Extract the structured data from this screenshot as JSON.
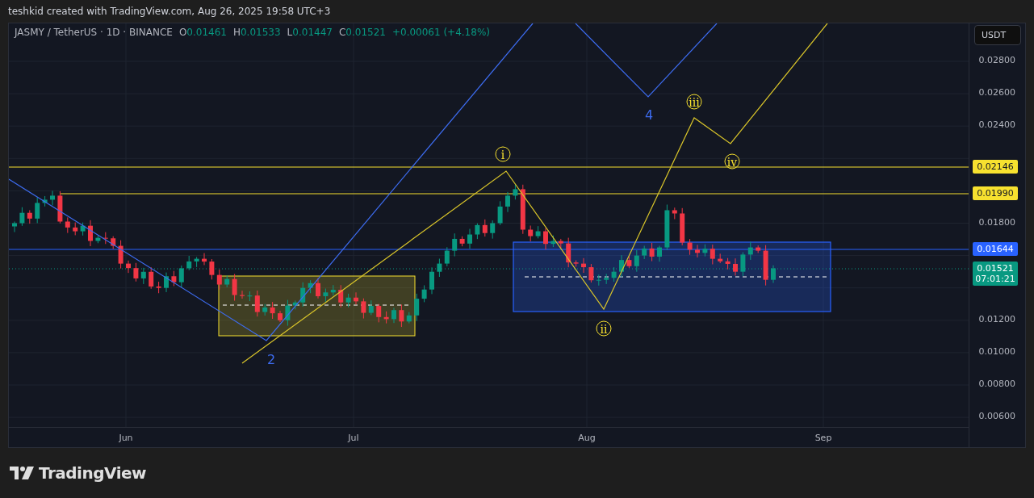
{
  "header": {
    "caption": "teshkid created with TradingView.com, Aug 26, 2025 19:58 UTC+3"
  },
  "legend": {
    "symbol": "JASMY / TetherUS · 1D · BINANCE",
    "ohlc": [
      {
        "key": "O",
        "value": "0.01461"
      },
      {
        "key": "H",
        "value": "0.01533"
      },
      {
        "key": "L",
        "value": "0.01447"
      },
      {
        "key": "C",
        "value": "0.01521"
      }
    ],
    "change": "+0.00061 (+4.18%)"
  },
  "currency_button": "USDT",
  "price_axis": {
    "ticks": [
      "0.02800",
      "0.02600",
      "0.02400",
      "0.01800",
      "0.01200",
      "0.01000",
      "0.00800",
      "0.00600"
    ]
  },
  "price_tags": [
    {
      "value": "0.02146",
      "color": "#f7e12f"
    },
    {
      "value": "0.01990",
      "color": "#f7e12f"
    },
    {
      "value": "0.01644",
      "color": "#2962ff"
    },
    {
      "value": "0.01521",
      "countdown": "07:01:21",
      "color": "#089981"
    }
  ],
  "wave_labels": [
    {
      "text": "iii",
      "kind": "circled"
    },
    {
      "text": "4",
      "kind": "plain"
    },
    {
      "text": "i",
      "kind": "circled"
    },
    {
      "text": "iv",
      "kind": "circled"
    },
    {
      "text": "ii",
      "kind": "circled"
    },
    {
      "text": "2",
      "kind": "plain"
    }
  ],
  "time_axis": {
    "labels": [
      "Jun",
      "Jul",
      "Aug",
      "Sep"
    ]
  },
  "footer": {
    "brand": "TradingView"
  }
}
